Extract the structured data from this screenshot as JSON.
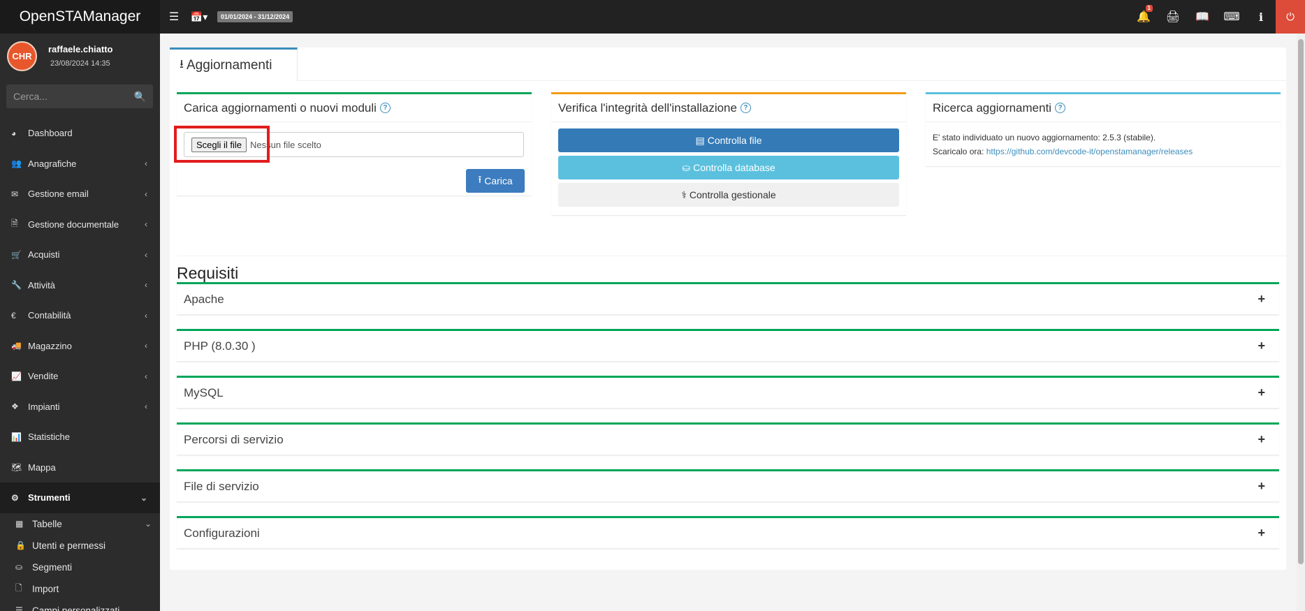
{
  "app": {
    "title": "OpenSTAManager"
  },
  "topbar": {
    "date_range": "01/01/2024 - 31/12/2024",
    "notification_count": "1",
    "icons": [
      "menu-icon",
      "calendar-icon",
      "bell-icon",
      "print-icon",
      "book-icon",
      "keyboard-icon",
      "info-icon",
      "power-icon"
    ]
  },
  "user": {
    "name": "raffaele.chiatto",
    "datetime": "23/08/2024 14:35",
    "avatar_text": "CHR"
  },
  "search": {
    "placeholder": "Cerca..."
  },
  "sidebar": {
    "items": [
      {
        "label": "Dashboard",
        "icon": "dashboard-icon"
      },
      {
        "label": "Anagrafiche",
        "icon": "users-icon"
      },
      {
        "label": "Gestione email",
        "icon": "envelope-icon"
      },
      {
        "label": "Gestione documentale",
        "icon": "file-icon"
      },
      {
        "label": "Acquisti",
        "icon": "cart-icon"
      },
      {
        "label": "Attività",
        "icon": "wrench-icon"
      },
      {
        "label": "Contabilità",
        "icon": "euro-icon"
      },
      {
        "label": "Magazzino",
        "icon": "truck-icon"
      },
      {
        "label": "Vendite",
        "icon": "chart-line-icon"
      },
      {
        "label": "Impianti",
        "icon": "puzzle-icon"
      },
      {
        "label": "Statistiche",
        "icon": "bar-chart-icon"
      },
      {
        "label": "Mappa",
        "icon": "map-icon"
      },
      {
        "label": "Strumenti",
        "icon": "cog-icon"
      }
    ],
    "sub_items": [
      {
        "label": "Tabelle",
        "icon": "table-icon"
      },
      {
        "label": "Utenti e permessi",
        "icon": "lock-icon"
      },
      {
        "label": "Segmenti",
        "icon": "database-icon"
      },
      {
        "label": "Import",
        "icon": "file-o-icon"
      },
      {
        "label": "Campi personalizzati",
        "icon": "list-icon"
      }
    ]
  },
  "page": {
    "tab": "Aggiornamenti",
    "upload": {
      "title": "Carica aggiornamenti o nuovi moduli",
      "file_button": "Scegli il file",
      "file_status": "Nessun file scelto",
      "submit": "Carica"
    },
    "integrity": {
      "title": "Verifica l'integrità dell'installazione",
      "btn_files": "Controlla file",
      "btn_database": "Controlla database",
      "btn_gestionale": "Controlla gestionale"
    },
    "updates": {
      "title": "Ricerca aggiornamenti",
      "message": "E' stato individuato un nuovo aggiornamento: 2.5.3 (stabile).",
      "download_label": "Scaricalo ora:",
      "download_link": "https://github.com/devcode-it/openstamanager/releases"
    },
    "requirements": {
      "title": "Requisiti",
      "sections": [
        "Apache",
        "PHP (8.0.30 )",
        "MySQL",
        "Percorsi di servizio",
        "File di servizio",
        "Configurazioni"
      ]
    }
  },
  "colors": {
    "primary": "#3c8dbc",
    "success": "#00a65a",
    "warning": "#f39c12",
    "info": "#5bc0de",
    "danger": "#dd4b39"
  }
}
